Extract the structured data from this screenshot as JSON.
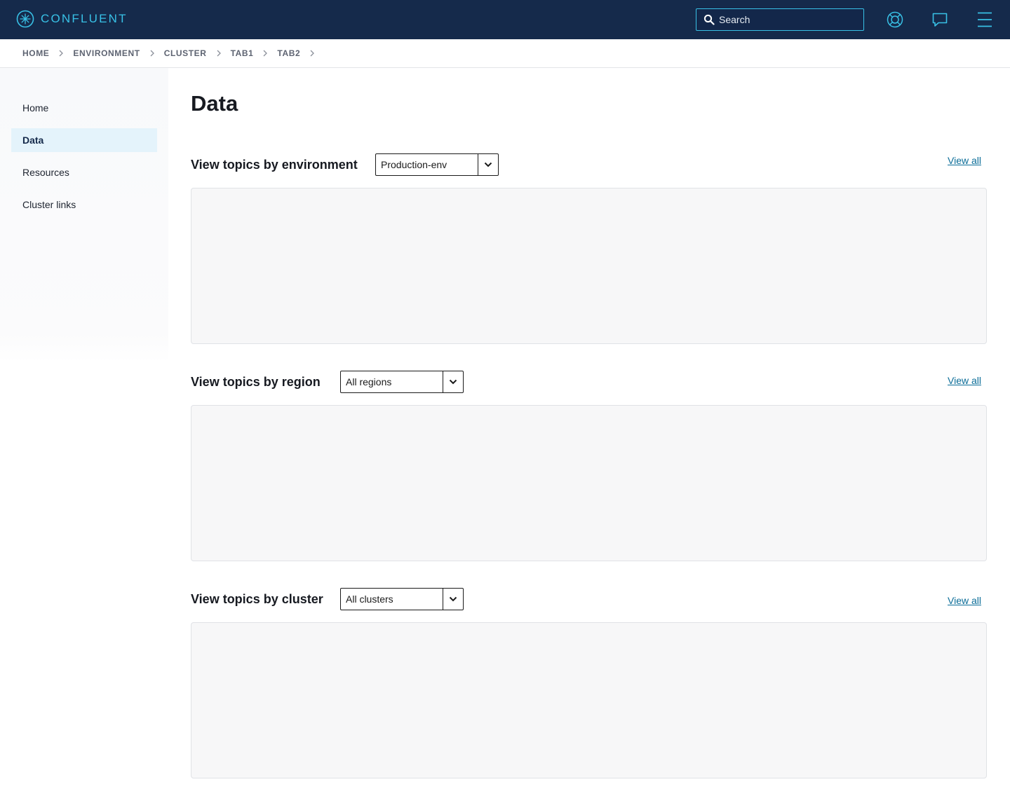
{
  "app": {
    "brand": "CONFLUENT",
    "search_placeholder": "Search"
  },
  "colors": {
    "nav_background": "#152a4b",
    "accent": "#38c1e6",
    "link": "#0b6d98",
    "active_nav": "#e4f3fb",
    "panel": "#f7f7f8"
  },
  "icons": [
    "confluent-logo-icon",
    "search-icon",
    "help-lifebuoy-icon",
    "chat-icon",
    "hamburger-menu-icon",
    "chevron-right-icon",
    "chevron-down-icon"
  ],
  "breadcrumb": [
    "HOME",
    "ENVIRONMENT",
    "CLUSTER",
    "TAB1",
    "TAB2"
  ],
  "sidebar": {
    "items": [
      {
        "label": "Home",
        "active": false
      },
      {
        "label": "Data",
        "active": true
      },
      {
        "label": "Resources",
        "active": false
      },
      {
        "label": "Cluster links",
        "active": false
      }
    ]
  },
  "main": {
    "title": "Data",
    "sections": [
      {
        "title": "View topics by environment",
        "selected": "Production-env",
        "link": "View all"
      },
      {
        "title": "View topics by region",
        "selected": "All regions",
        "link": "View all"
      },
      {
        "title": "View topics by cluster",
        "selected": "All clusters",
        "link": "View all"
      }
    ]
  }
}
